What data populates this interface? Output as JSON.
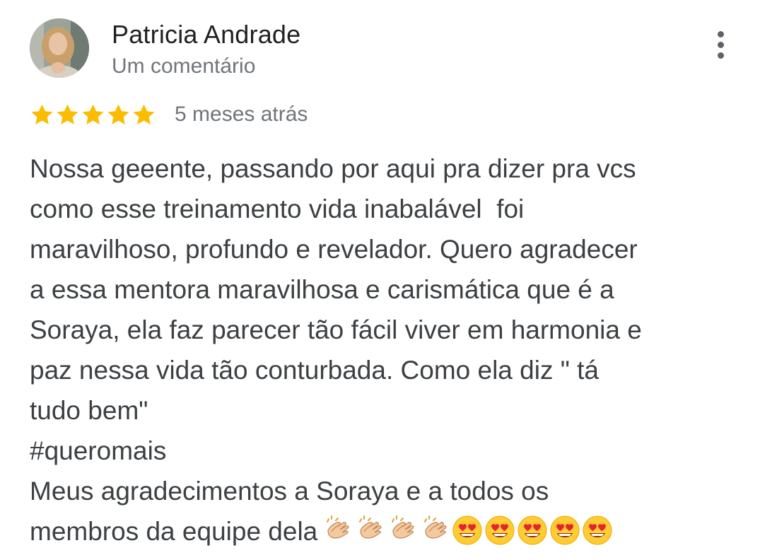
{
  "review": {
    "author_name": "Patricia Andrade",
    "author_meta": "Um comentário",
    "rating": 5,
    "rating_max": 5,
    "date": "5 meses atrás",
    "star_color": "#fbbc04",
    "lines": [
      "Nossa geeente, passando por aqui pra dizer pra vcs",
      "como esse treinamento vida inabalável  foi",
      "maravilhoso, profundo e revelador. Quero agradecer",
      "a essa mentora maravilhosa e carismática que é a",
      "Soraya, ela faz parecer tão fácil viver em harmonia e",
      "paz nessa vida tão conturbada. Como ela diz \" tá",
      "tudo bem\"",
      "#queromais",
      "Meus agradecimentos a Soraya e a todos os",
      "membros da equipe dela"
    ],
    "emojis": [
      "clapping-hands-icon",
      "clapping-hands-icon",
      "clapping-hands-icon",
      "clapping-hands-icon",
      "heart-eyes-icon",
      "heart-eyes-icon",
      "heart-eyes-icon",
      "heart-eyes-icon",
      "heart-eyes-icon"
    ]
  },
  "icons": {
    "more": "more-vert-icon",
    "avatar": "avatar"
  }
}
